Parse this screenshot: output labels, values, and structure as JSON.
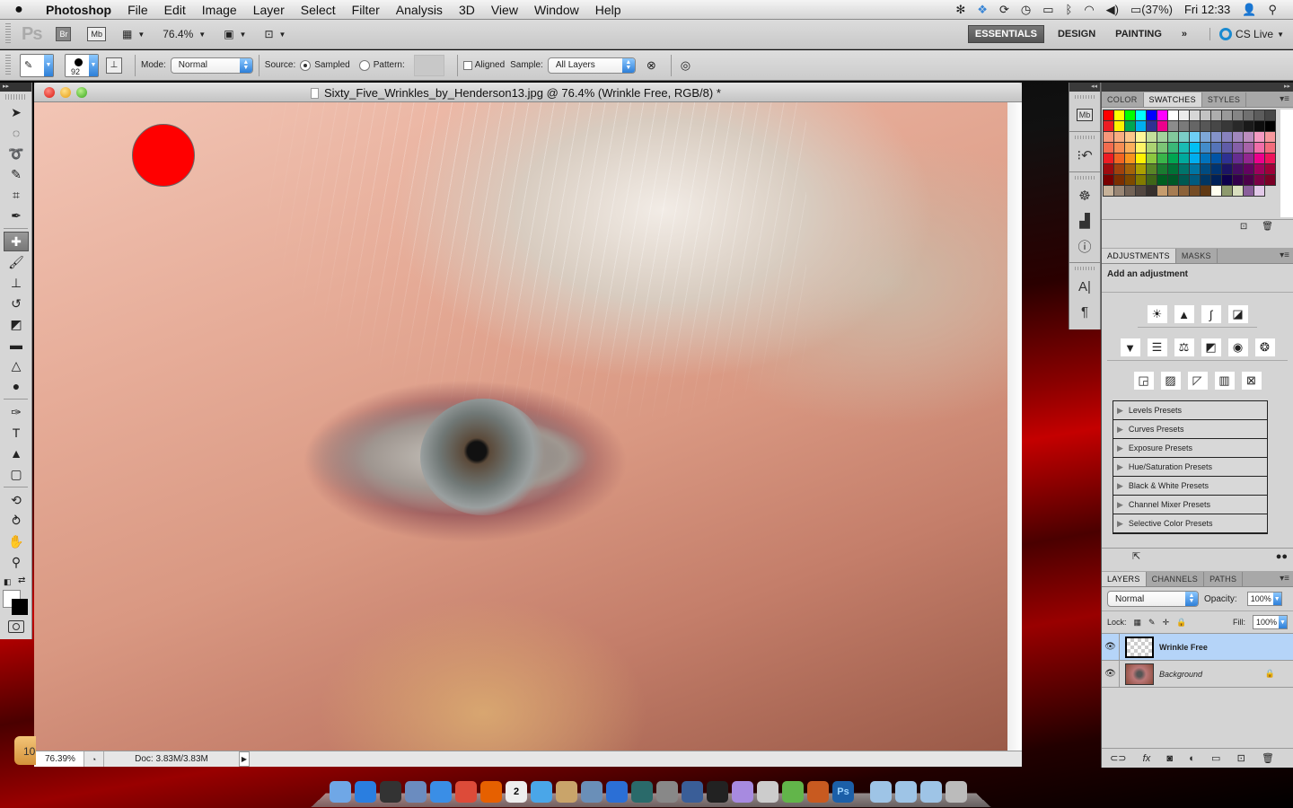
{
  "menubar": {
    "app": "Photoshop",
    "items": [
      "File",
      "Edit",
      "Image",
      "Layer",
      "Select",
      "Filter",
      "Analysis",
      "3D",
      "View",
      "Window",
      "Help"
    ],
    "status": {
      "battery": "(37%)",
      "clock": "Fri 12:33"
    },
    "status_icons": [
      "activity-icon",
      "dropbox-icon",
      "sync-icon",
      "time-machine-icon",
      "display-icon",
      "bluetooth-icon",
      "wifi-icon",
      "volume-icon",
      "battery-icon",
      "user-icon",
      "spotlight-icon"
    ]
  },
  "appbar": {
    "logo": "Ps",
    "bridge": "Br",
    "minibridge": "Mb",
    "zoom": "76.4%",
    "workspaces": [
      "ESSENTIALS",
      "DESIGN",
      "PAINTING"
    ],
    "active_workspace": "ESSENTIALS",
    "more": "»",
    "cslive": "CS Live"
  },
  "options": {
    "brush_size": "92",
    "mode_label": "Mode:",
    "mode_value": "Normal",
    "source_label": "Source:",
    "source_sampled": "Sampled",
    "source_pattern": "Pattern:",
    "aligned": "Aligned",
    "sample_label": "Sample:",
    "sample_value": "All Layers"
  },
  "toolbox": {
    "tools": [
      {
        "name": "move-tool",
        "glyph": "➤"
      },
      {
        "name": "marquee-tool",
        "glyph": "◌"
      },
      {
        "name": "lasso-tool",
        "glyph": "➰"
      },
      {
        "name": "quick-selection-tool",
        "glyph": "✎"
      },
      {
        "name": "crop-tool",
        "glyph": "⌗"
      },
      {
        "name": "eyedropper-tool",
        "glyph": "✒"
      },
      {
        "name": "spot-healing-brush-tool",
        "glyph": "✚",
        "active": true
      },
      {
        "name": "brush-tool",
        "glyph": "🖌"
      },
      {
        "name": "clone-stamp-tool",
        "glyph": "⊥"
      },
      {
        "name": "history-brush-tool",
        "glyph": "↺"
      },
      {
        "name": "eraser-tool",
        "glyph": "◩"
      },
      {
        "name": "gradient-tool",
        "glyph": "▬"
      },
      {
        "name": "blur-tool",
        "glyph": "△"
      },
      {
        "name": "dodge-tool",
        "glyph": "●"
      },
      {
        "name": "pen-tool",
        "glyph": "✑"
      },
      {
        "name": "type-tool",
        "glyph": "T"
      },
      {
        "name": "path-selection-tool",
        "glyph": "▲"
      },
      {
        "name": "shape-tool",
        "glyph": "▢"
      },
      {
        "name": "3d-rotate-tool",
        "glyph": "⟲"
      },
      {
        "name": "3d-orbit-tool",
        "glyph": "⥁"
      },
      {
        "name": "hand-tool",
        "glyph": "✋"
      },
      {
        "name": "zoom-tool",
        "glyph": "⚲"
      }
    ]
  },
  "document": {
    "title": "Sixty_Five_Wrinkles_by_Henderson13.jpg @ 76.4% (Wrinkle Free, RGB/8) *",
    "zoom": "76.39%",
    "doc_size": "Doc: 3.83M/3.83M",
    "brush_cursor_color": "#ff0000"
  },
  "swatches_panel": {
    "tabs": [
      "COLOR",
      "SWATCHES",
      "STYLES"
    ],
    "active": "SWATCHES",
    "colors": [
      "#ff0000",
      "#ffff00",
      "#00ff00",
      "#00ffff",
      "#0000ff",
      "#ff00ff",
      "#ffffff",
      "#ebebeb",
      "#d6d6d6",
      "#c2c2c2",
      "#adadad",
      "#999999",
      "#858585",
      "#707070",
      "#5c5c5c",
      "#474747",
      "#ed1c24",
      "#fff200",
      "#00a651",
      "#00aeef",
      "#2e3192",
      "#ec008c",
      "#8c8c8c",
      "#7a7a7a",
      "#666666",
      "#575757",
      "#474747",
      "#383838",
      "#292929",
      "#1a1a1a",
      "#0d0d0d",
      "#000000",
      "#f7977a",
      "#f9ad81",
      "#fdc68a",
      "#fff79a",
      "#c4df9b",
      "#a3d39c",
      "#82ca9d",
      "#7bcdc8",
      "#6ecff6",
      "#7ea7d8",
      "#8493ca",
      "#8882be",
      "#a187be",
      "#bc8dbf",
      "#f49ac2",
      "#f6989d",
      "#f26c4f",
      "#f68e55",
      "#fbaf5c",
      "#fff467",
      "#acd372",
      "#7cc576",
      "#3bb878",
      "#1abbb4",
      "#00bff3",
      "#438cca",
      "#5574b9",
      "#605ca8",
      "#855fa8",
      "#a763a8",
      "#f06ea9",
      "#f26d7d",
      "#ed1c24",
      "#f26522",
      "#f7941d",
      "#fff200",
      "#8dc73f",
      "#39b54a",
      "#00a651",
      "#00a99d",
      "#00aeef",
      "#0072bc",
      "#0054a6",
      "#2e3192",
      "#662d91",
      "#92278f",
      "#ec008c",
      "#ed145b",
      "#9e0b0f",
      "#a0410d",
      "#a36209",
      "#aba000",
      "#598527",
      "#1a7b30",
      "#007236",
      "#00746b",
      "#0076a3",
      "#004b80",
      "#003471",
      "#1b1464",
      "#440e62",
      "#630460",
      "#9e005d",
      "#9e0039",
      "#790000",
      "#7b2e00",
      "#7d4900",
      "#827b00",
      "#406618",
      "#005e20",
      "#005826",
      "#005952",
      "#005b7f",
      "#003663",
      "#002157",
      "#0d004c",
      "#32004b",
      "#4b0049",
      "#7b0046",
      "#7a0026",
      "#c7b299",
      "#998675",
      "#736357",
      "#534741",
      "#37302d",
      "#c69c6d",
      "#a67c52",
      "#8c6239",
      "#754c24",
      "#603913",
      "#fffff0",
      "#8e9a6e",
      "#d9dfbf",
      "#8a5f9b",
      "#e2c9e8"
    ]
  },
  "adjustments_panel": {
    "tabs": [
      "ADJUSTMENTS",
      "MASKS"
    ],
    "active": "ADJUSTMENTS",
    "title": "Add an adjustment",
    "icons_row1": [
      "brightness-contrast-icon",
      "levels-icon",
      "curves-icon",
      "exposure-icon"
    ],
    "icons_row2": [
      "vibrance-icon",
      "hue-saturation-icon",
      "color-balance-icon",
      "black-white-icon",
      "photo-filter-icon",
      "channel-mixer-icon"
    ],
    "icons_row3": [
      "invert-icon",
      "posterize-icon",
      "threshold-icon",
      "gradient-map-icon",
      "selective-color-icon"
    ],
    "presets": [
      "Levels Presets",
      "Curves Presets",
      "Exposure Presets",
      "Hue/Saturation Presets",
      "Black & White Presets",
      "Channel Mixer Presets",
      "Selective Color Presets"
    ]
  },
  "layers_panel": {
    "tabs": [
      "LAYERS",
      "CHANNELS",
      "PATHS"
    ],
    "active": "LAYERS",
    "blend_mode": "Normal",
    "opacity_label": "Opacity:",
    "opacity": "100%",
    "lock_label": "Lock:",
    "fill_label": "Fill:",
    "fill": "100%",
    "layers": [
      {
        "name": "Wrinkle Free",
        "selected": true,
        "locked": false
      },
      {
        "name": "Background",
        "selected": false,
        "locked": true
      }
    ]
  },
  "dock": {
    "apps": [
      "Finder",
      "App Store",
      "Dashboard",
      "Mail",
      "Safari",
      "Chrome",
      "Firefox",
      "iCal",
      "FaceTime",
      "Address Book",
      "iPhoto",
      "iTunes",
      "Time Machine",
      "System Preferences",
      "QuickTime",
      "Final Cut Pro",
      "Color",
      "Preview",
      "Evernote",
      "GarageBand",
      "Photoshop",
      "Applications",
      "Documents",
      "Downloads",
      "Trash"
    ],
    "calendar_day": "2"
  },
  "left_edge_badge": "10"
}
